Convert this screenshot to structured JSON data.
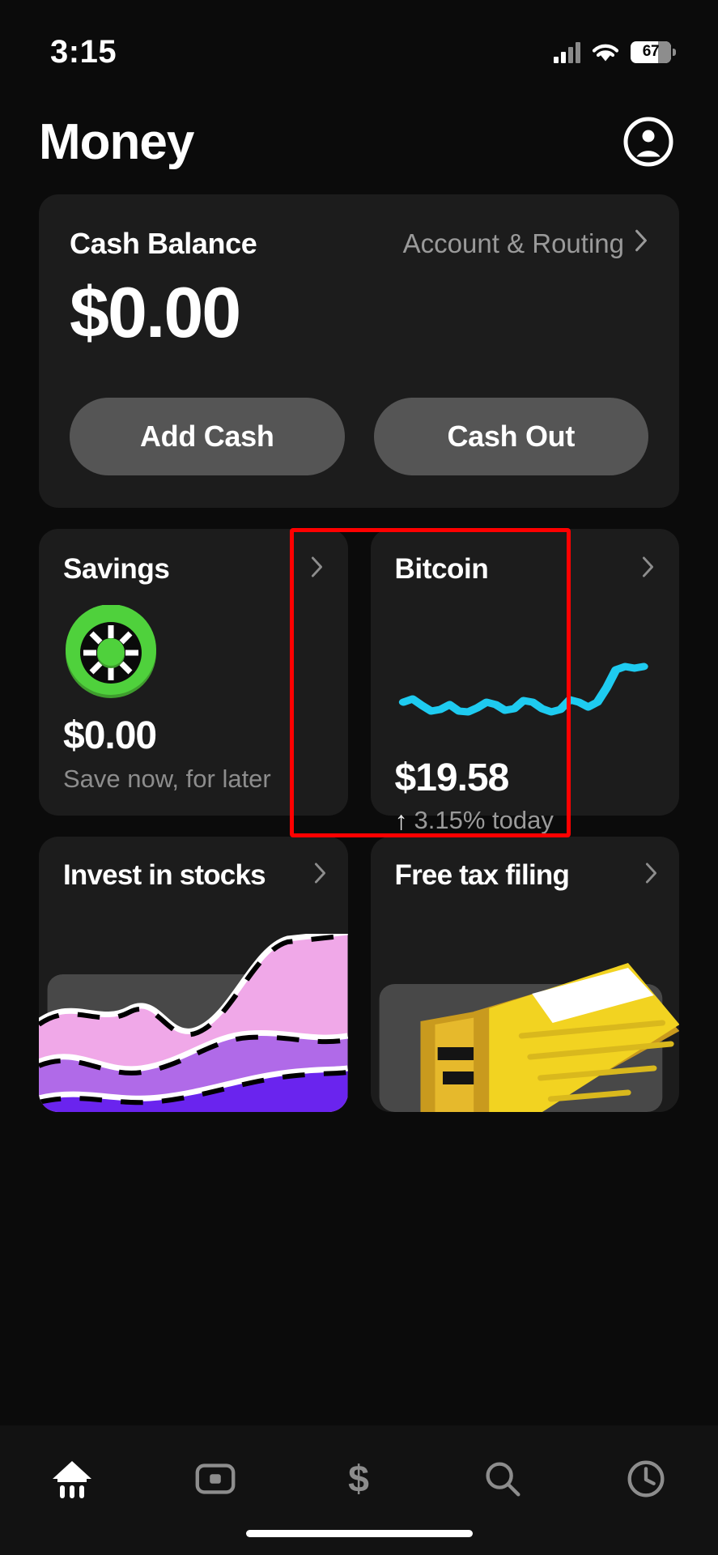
{
  "status_bar": {
    "time": "3:15",
    "battery_level": "67",
    "icons": [
      "cellular-signal-icon",
      "wifi-icon",
      "battery-icon"
    ]
  },
  "header": {
    "title": "Money",
    "avatar_icon": "account-circle-icon"
  },
  "cash_card": {
    "label": "Cash Balance",
    "account_routing_label": "Account & Routing",
    "chevron": "›",
    "amount": "$0.00",
    "add_cash_label": "Add Cash",
    "cash_out_label": "Cash Out"
  },
  "savings_card": {
    "title": "Savings",
    "chevron": "›",
    "icon": "vault-dial-icon",
    "amount": "$0.00",
    "subtitle": "Save now, for later",
    "accent_color": "#4ac93a"
  },
  "bitcoin_card": {
    "title": "Bitcoin",
    "chevron": "›",
    "price": "$19.58",
    "change_arrow": "↑",
    "change_text": "3.15% today",
    "line_color": "#1ecbf0",
    "highlighted": true,
    "highlight_color": "#ff0000",
    "chart_data": {
      "type": "line",
      "title": "Bitcoin price sparkline",
      "x": [
        0,
        1,
        2,
        3,
        4,
        5,
        6,
        7,
        8,
        9,
        10,
        11,
        12,
        13,
        14,
        15,
        16,
        17,
        18,
        19,
        20,
        21,
        22,
        23,
        24,
        25,
        26
      ],
      "values": [
        44,
        48,
        40,
        33,
        35,
        41,
        33,
        32,
        37,
        44,
        41,
        34,
        36,
        46,
        44,
        36,
        32,
        35,
        47,
        44,
        38,
        44,
        62,
        84,
        88,
        86,
        88
      ],
      "ylim": [
        0,
        100
      ],
      "grid": false,
      "legend": "none"
    }
  },
  "invest_card": {
    "title": "Invest in stocks",
    "chevron": "›",
    "art": "stock-chart-illustration"
  },
  "tax_card": {
    "title": "Free tax filing",
    "chevron": "›",
    "art": "tax-documents-illustration"
  },
  "tab_bar": {
    "items": [
      {
        "name": "home-tab",
        "icon": "cash-app-home-icon",
        "active": true
      },
      {
        "name": "card-tab",
        "icon": "card-icon",
        "active": false
      },
      {
        "name": "money-tab",
        "icon": "dollar-sign-icon",
        "active": false
      },
      {
        "name": "search-tab",
        "icon": "search-icon",
        "active": false
      },
      {
        "name": "activity-tab",
        "icon": "clock-icon",
        "active": false
      }
    ]
  }
}
